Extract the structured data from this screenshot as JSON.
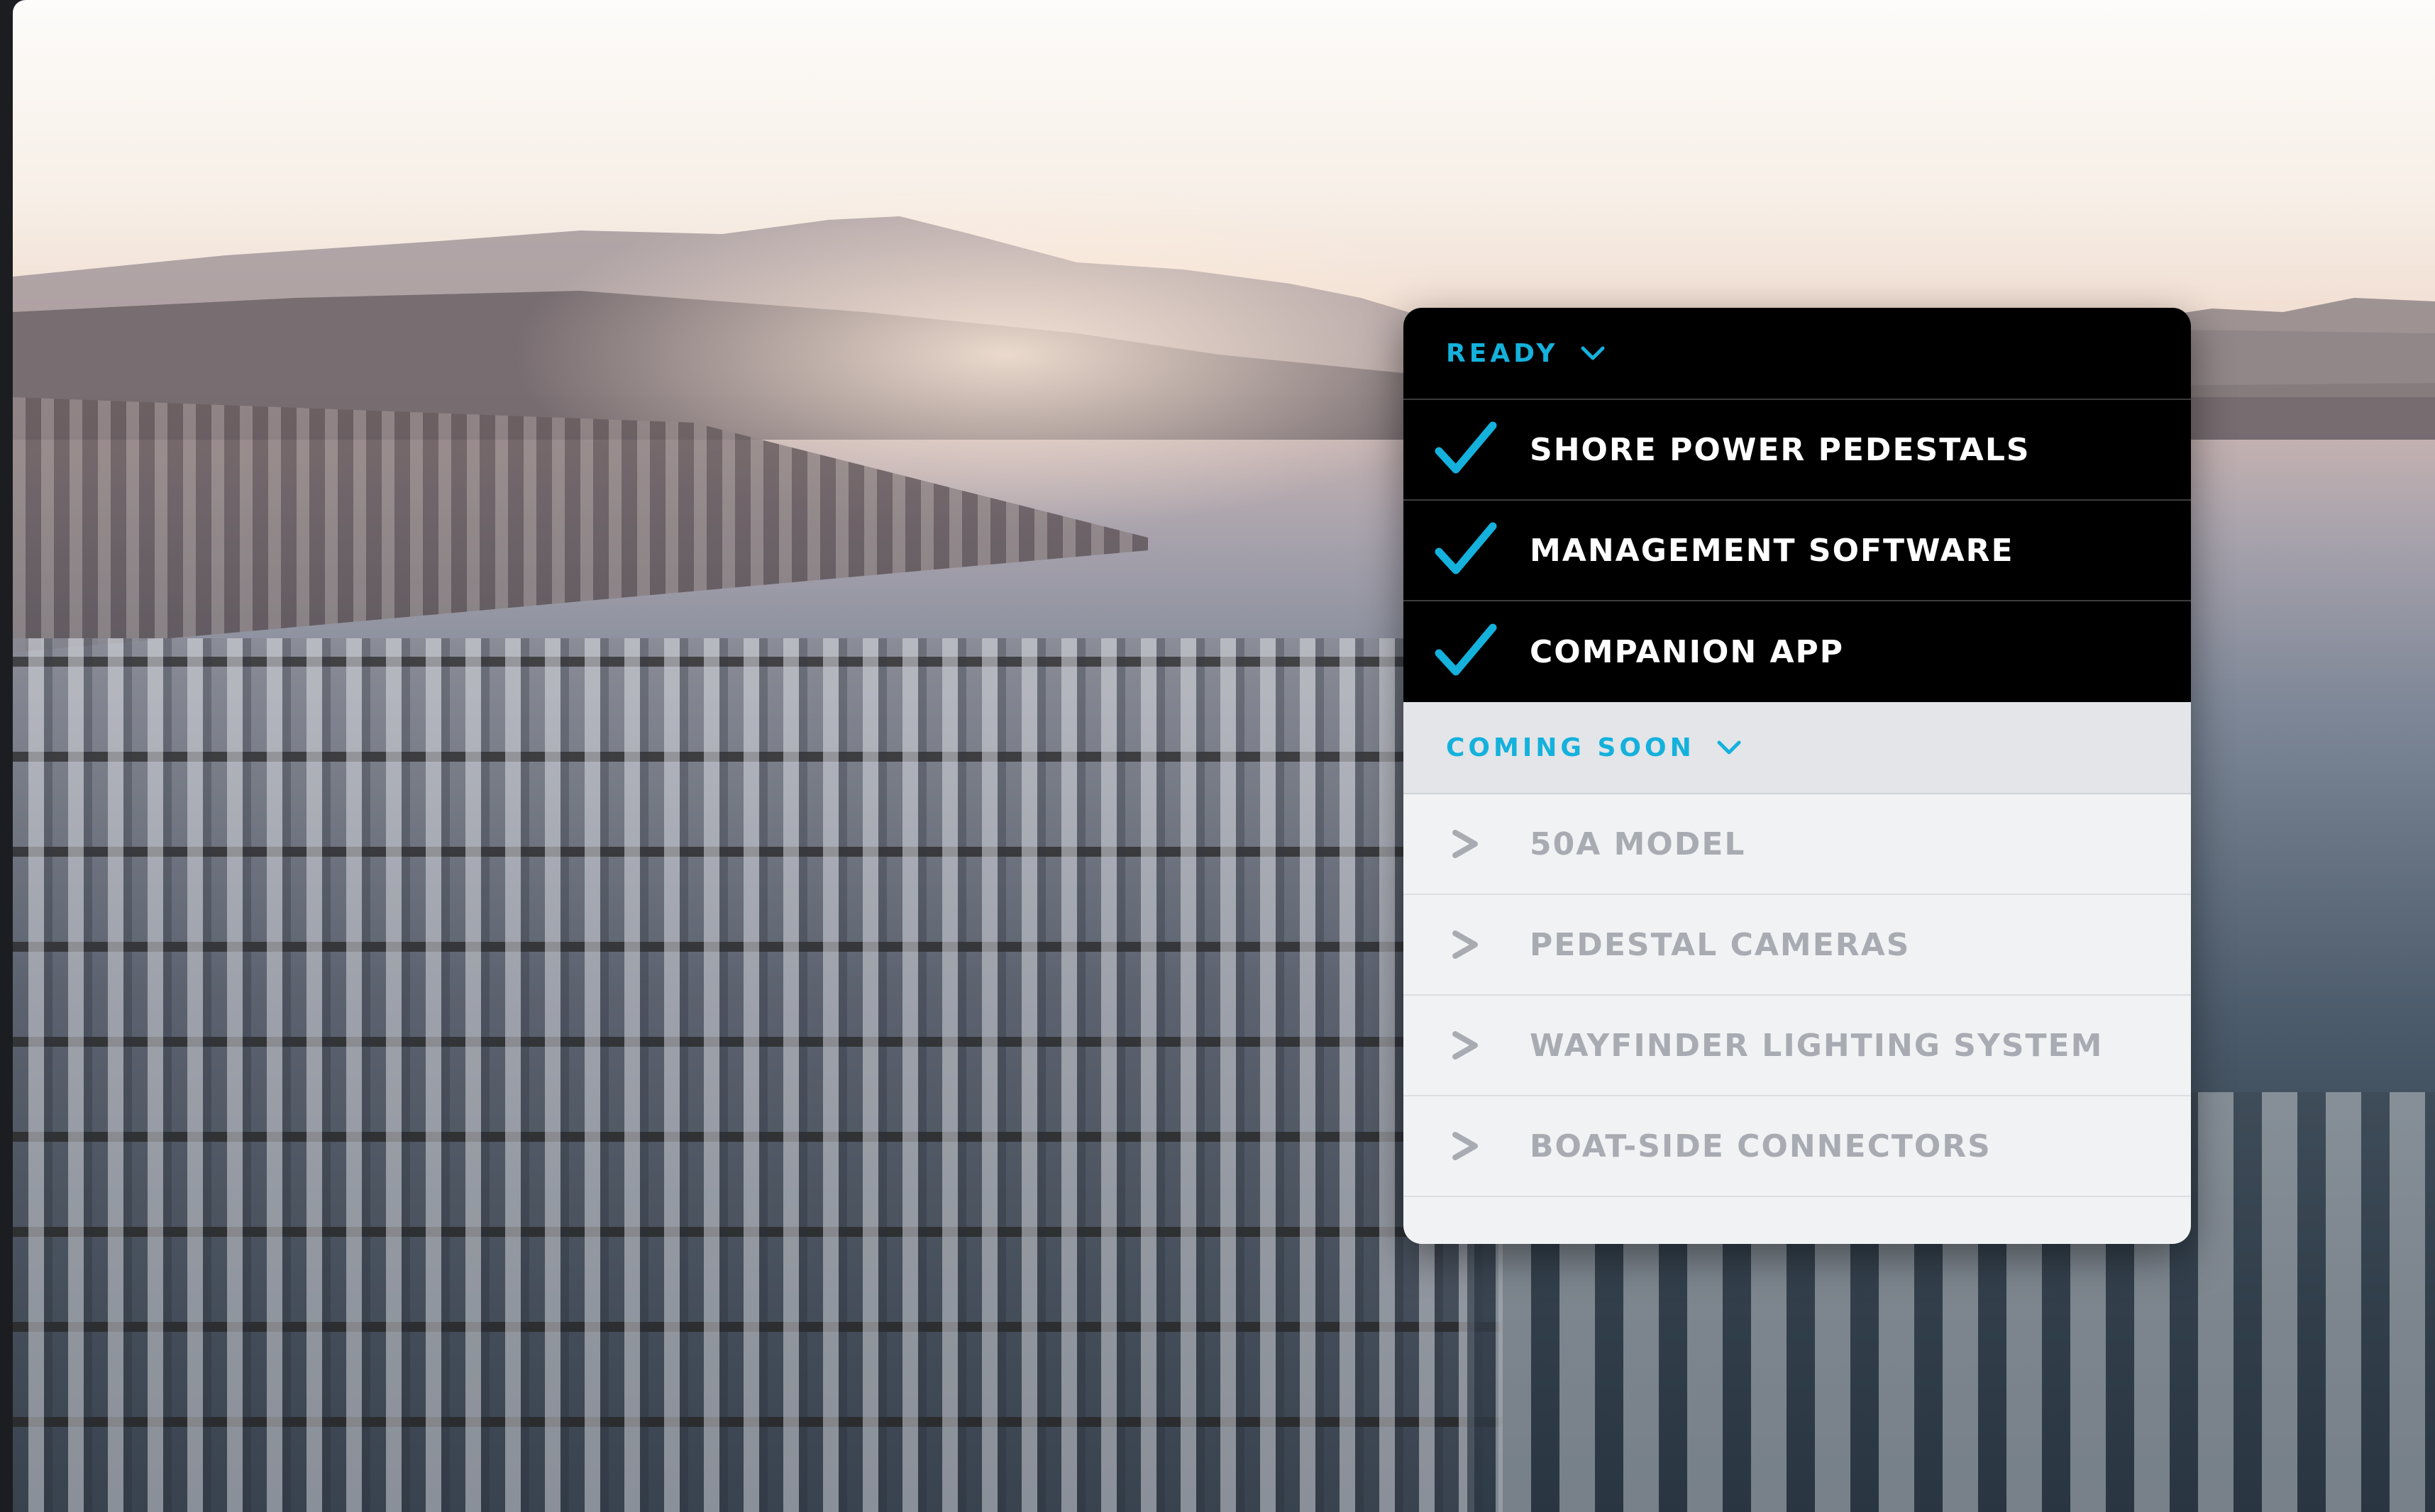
{
  "ready_section": {
    "title": "READY",
    "items": [
      {
        "label": "SHORE POWER PEDESTALS",
        "icon": "checkmark-icon"
      },
      {
        "label": "MANAGEMENT SOFTWARE",
        "icon": "checkmark-icon"
      },
      {
        "label": "COMPANION APP",
        "icon": "checkmark-icon"
      }
    ]
  },
  "coming_soon_section": {
    "title": "COMING SOON",
    "items": [
      {
        "label": "50A MODEL",
        "icon": "chevron-right-icon"
      },
      {
        "label": "PEDESTAL CAMERAS",
        "icon": "chevron-right-icon"
      },
      {
        "label": "WAYFINDER LIGHTING SYSTEM",
        "icon": "chevron-right-icon"
      },
      {
        "label": "BOAT-SIDE CONNECTORS",
        "icon": "chevron-right-icon"
      }
    ]
  },
  "colors": {
    "accent": "#14b1dc",
    "ready_bg": "#000000",
    "coming_soon_bg": "#f1f2f4",
    "coming_soon_text": "#a8acb2"
  }
}
